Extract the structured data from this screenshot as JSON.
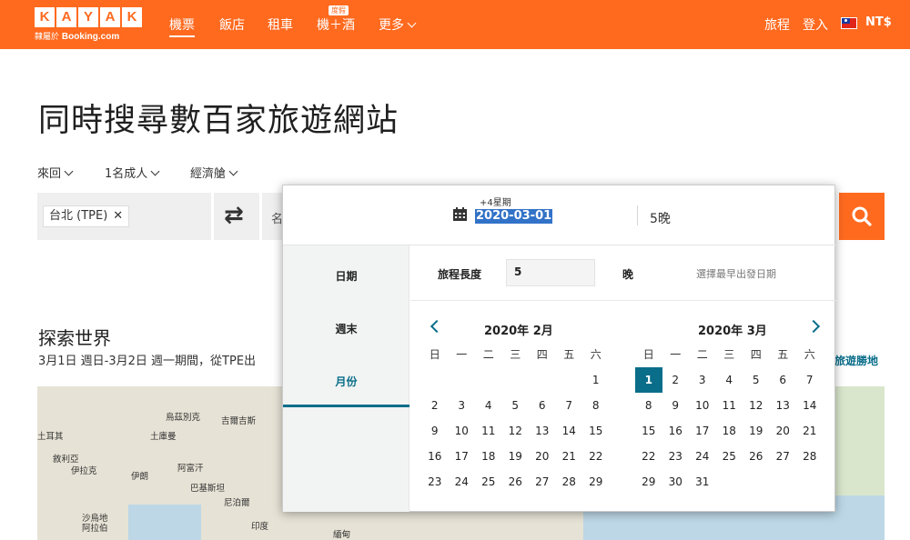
{
  "header": {
    "logo_letters": [
      "K",
      "A",
      "Y",
      "A",
      "K"
    ],
    "logo_sub_prefix": "隸屬於",
    "logo_sub_brand": "Booking.com",
    "nav": [
      {
        "label": "機票",
        "active": true
      },
      {
        "label": "飯店"
      },
      {
        "label": "租車"
      },
      {
        "label": "機＋酒",
        "badge": "度假"
      },
      {
        "label": "更多"
      }
    ],
    "trips": "旅程",
    "login": "登入",
    "currency": "NT$",
    "brand_color": "#ff6a1f"
  },
  "page_title": "同時搜尋數百家旅遊網站",
  "options": {
    "trip_type": "來回",
    "travelers": "1名成人",
    "cabin": "經濟艙"
  },
  "search": {
    "origin": "台北 (TPE)",
    "destination_partial": "名",
    "search_icon": "search-icon"
  },
  "explore": {
    "title": "探索世界",
    "subtitle": "3月1日 週日-3月2日 週一期間，從TPE出",
    "link": "旅遊勝地"
  },
  "map_labels": [
    "烏茲別克",
    "吉爾吉斯",
    "土庫曼",
    "土耳其",
    "敘利亞",
    "伊拉克",
    "伊朗",
    "阿富汗",
    "巴基斯坦",
    "沙烏地",
    "阿拉伯",
    "尼泊爾",
    "印度",
    "緬甸"
  ],
  "date_popup": {
    "hint": "+4星期",
    "date": "2020-03-01",
    "nights": "5晚",
    "tabs": [
      "日期",
      "週末",
      "月份"
    ],
    "active_tab": "月份",
    "trip_length_label": "旅程長度",
    "trip_length_value": "5",
    "night_label": "晚",
    "choose_earliest": "選擇最早出發日期",
    "weekdays": [
      "日",
      "一",
      "二",
      "三",
      "四",
      "五",
      "六"
    ],
    "months": [
      {
        "title": "2020年 2月",
        "offset": 6,
        "days": [
          "1",
          "2",
          "3",
          "4",
          "5",
          "6",
          "7",
          "8",
          "9",
          "10",
          "11",
          "12",
          "13",
          "14",
          "15",
          "16",
          "17",
          "18",
          "19",
          "20",
          "21",
          "22",
          "23",
          "24",
          "25",
          "26",
          "27",
          "28",
          "29"
        ]
      },
      {
        "title": "2020年 3月",
        "offset": 0,
        "selected": "1",
        "days": [
          "1",
          "2",
          "3",
          "4",
          "5",
          "6",
          "7",
          "8",
          "9",
          "10",
          "11",
          "12",
          "13",
          "14",
          "15",
          "16",
          "17",
          "18",
          "19",
          "20",
          "21",
          "22",
          "23",
          "24",
          "25",
          "26",
          "27",
          "28",
          "29",
          "30",
          "31"
        ]
      }
    ]
  }
}
